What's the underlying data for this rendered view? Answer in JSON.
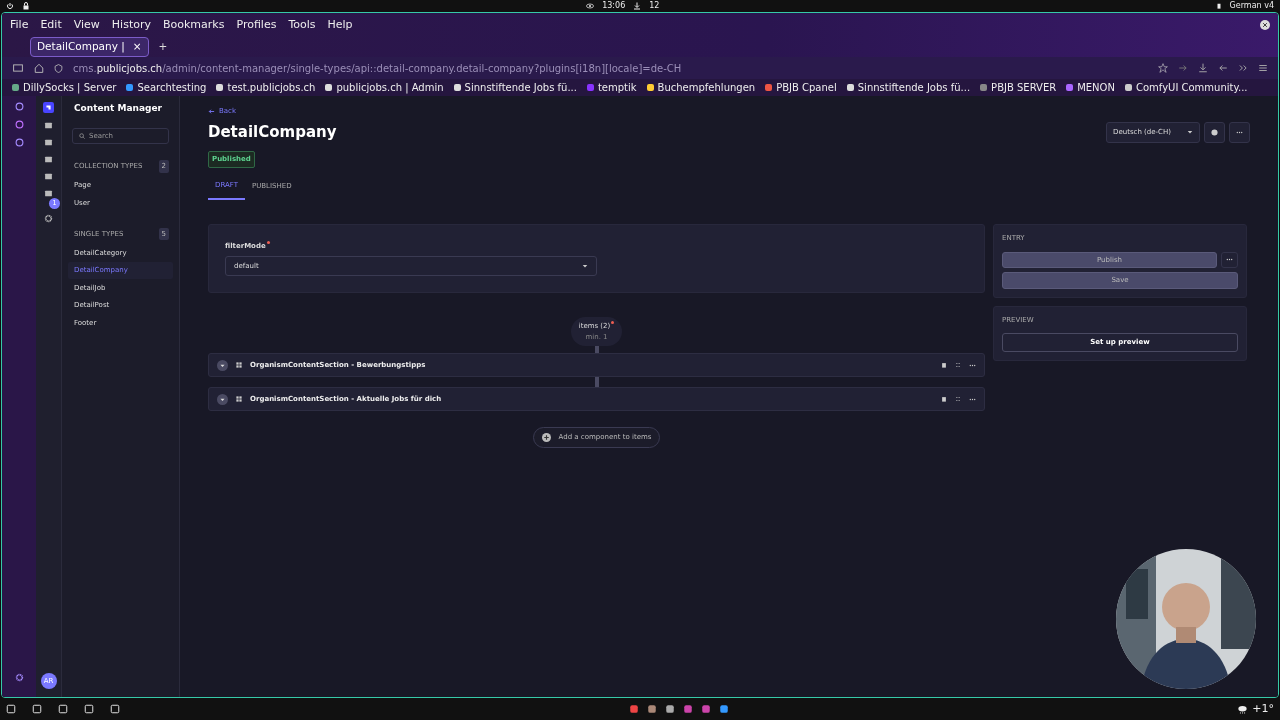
{
  "system_bar": {
    "time": "13:06",
    "downloads": "12",
    "keyboard": "German v4"
  },
  "menu": [
    "File",
    "Edit",
    "View",
    "History",
    "Bookmarks",
    "Profiles",
    "Tools",
    "Help"
  ],
  "tabs": [
    {
      "label": "DetailCompany |",
      "selected": true,
      "close": "×"
    }
  ],
  "new_tab": "+",
  "url": {
    "prefix": "cms.",
    "domain": "publicjobs.ch",
    "path": "/admin/content-manager/single-types/api::detail-company.detail-company?plugins[i18n][locale]=de-CH"
  },
  "bookmarks": [
    "DillySocks | Server",
    "Searchtesting",
    "test.publicjobs.ch",
    "publicjobs.ch | Admin",
    "Sinnstiftende Jobs fü...",
    "temptik",
    "Buchempfehlungen",
    "PBJB Cpanel",
    "Sinnstiftende Jobs fü...",
    "PBJB SERVER",
    "MENON",
    "ComfyUI Community..."
  ],
  "nav": {
    "settings_badge": "1",
    "avatar": "AR"
  },
  "content_sidebar": {
    "title": "Content Manager",
    "search": {
      "placeholder": "Search"
    },
    "sections": [
      {
        "label": "COLLECTION TYPES",
        "count": "2",
        "items": [
          {
            "label": "Page",
            "selected": false
          },
          {
            "label": "User",
            "selected": false
          }
        ]
      },
      {
        "label": "SINGLE TYPES",
        "count": "5",
        "items": [
          {
            "label": "DetailCategory",
            "selected": false
          },
          {
            "label": "DetailCompany",
            "selected": true
          },
          {
            "label": "DetailJob",
            "selected": false
          },
          {
            "label": "DetailPost",
            "selected": false
          },
          {
            "label": "Footer",
            "selected": false
          }
        ]
      }
    ]
  },
  "header": {
    "back": "Back",
    "title": "DetailCompany",
    "status": "Published",
    "locale": "Deutsch (de-CH)",
    "tabs": [
      {
        "label": "DRAFT",
        "selected": true
      },
      {
        "label": "PUBLISHED",
        "selected": false
      }
    ]
  },
  "field": {
    "label": "filterMode",
    "required": true,
    "value": "default"
  },
  "dynamic_zone": {
    "label": "items (2)",
    "required": true,
    "hint": "min. 1",
    "components": [
      {
        "title": "OrganismContentSection - Bewerbungstipps"
      },
      {
        "title": "OrganismContentSection - Aktuelle Jobs für dich"
      }
    ],
    "add": "Add a component to items"
  },
  "entry_panel": {
    "heading": "ENTRY",
    "publish": "Publish",
    "save": "Save"
  },
  "preview_panel": {
    "heading": "PREVIEW",
    "button": "Set up preview"
  },
  "taskbar": {
    "weather": "+1°"
  }
}
